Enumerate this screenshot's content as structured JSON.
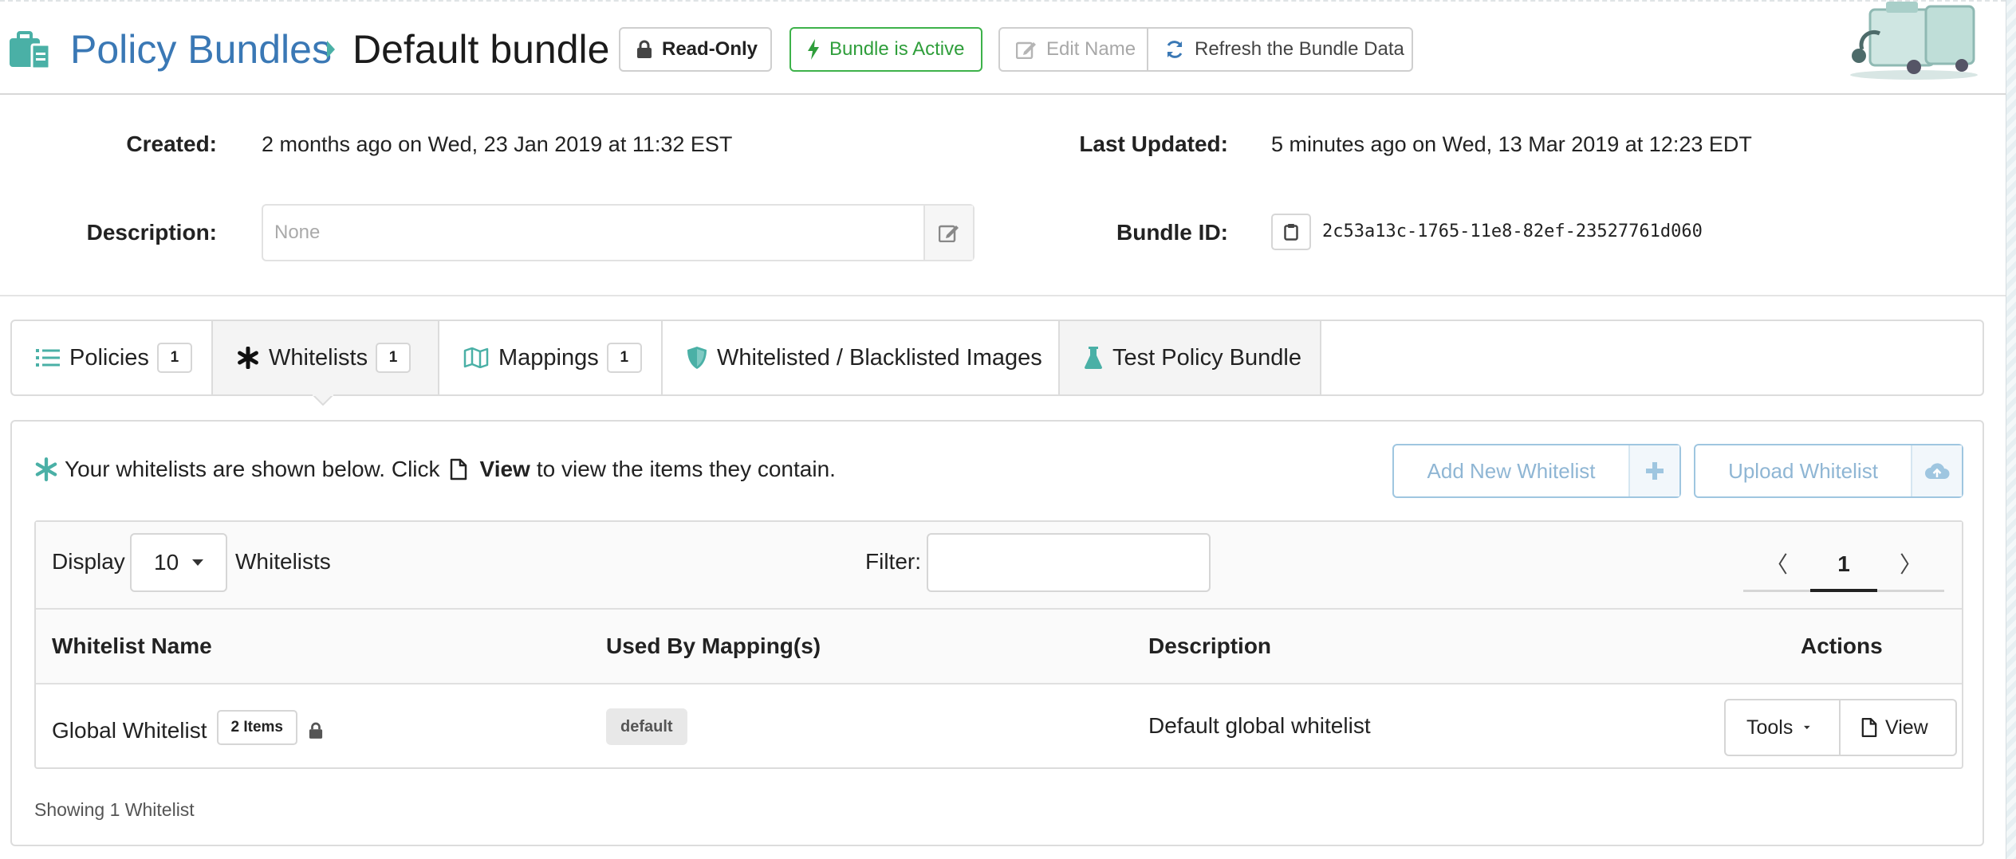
{
  "header": {
    "breadcrumb_root": "Policy Bundles",
    "breadcrumb_current": "Default bundle",
    "readonly_label": "Read-Only",
    "active_label": "Bundle is Active",
    "edit_name_label": "Edit Name",
    "refresh_label": "Refresh the Bundle Data"
  },
  "info": {
    "created_label": "Created:",
    "created_value": "2 months ago on Wed, 23 Jan 2019 at 11:32 EST",
    "updated_label": "Last Updated:",
    "updated_value": "5 minutes ago on Wed, 13 Mar 2019 at 12:23 EDT",
    "description_label": "Description:",
    "description_placeholder": "None",
    "bundle_id_label": "Bundle ID:",
    "bundle_id_value": "2c53a13c-1765-11e8-82ef-23527761d060"
  },
  "tabs": [
    {
      "label": "Policies",
      "count": "1",
      "icon": "list-icon"
    },
    {
      "label": "Whitelists",
      "count": "1",
      "icon": "asterisk-icon"
    },
    {
      "label": "Mappings",
      "count": "1",
      "icon": "map-icon"
    },
    {
      "label": "Whitelisted / Blacklisted Images",
      "icon": "shield-icon"
    },
    {
      "label": "Test Policy Bundle",
      "icon": "flask-icon"
    }
  ],
  "active_tab": "Whitelists",
  "panel": {
    "intro_prefix": "Your whitelists are shown below. Click",
    "intro_view": "View",
    "intro_suffix": "to view the items they contain.",
    "add_new_label": "Add New Whitelist",
    "upload_label": "Upload Whitelist"
  },
  "toolbar": {
    "display_label": "Display",
    "page_size": "10",
    "display_suffix": "Whitelists",
    "filter_label": "Filter:",
    "filter_value": "",
    "prev": "〈",
    "page": "1",
    "next": "〉"
  },
  "table": {
    "columns": [
      "Whitelist Name",
      "Used By Mapping(s)",
      "Description",
      "Actions"
    ],
    "rows": [
      {
        "name": "Global Whitelist",
        "items": "2 Items",
        "mapping": "default",
        "description": "Default global whitelist",
        "tools_label": "Tools",
        "view_label": "View"
      }
    ]
  },
  "footer": {
    "showing": "Showing 1 Whitelist"
  },
  "colors": {
    "link_blue": "#3a78b5",
    "teal": "#4ab0a6",
    "active_green": "#3db24a",
    "disabled_blue": "#8fb6d4"
  }
}
